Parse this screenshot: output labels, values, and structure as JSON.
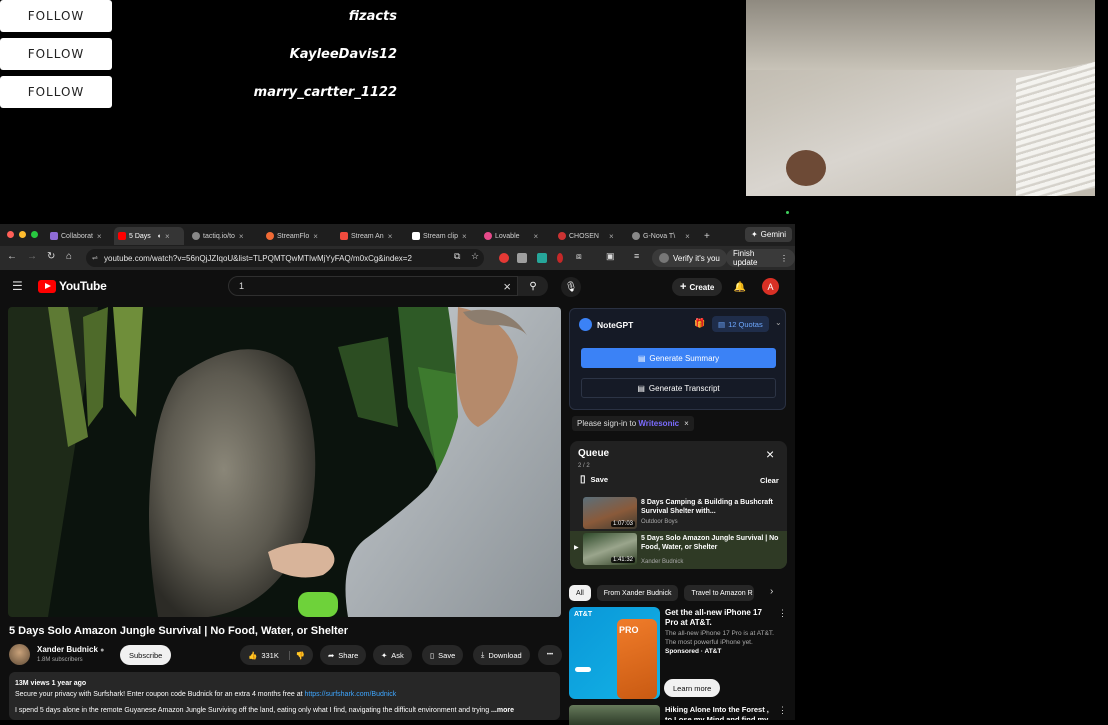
{
  "overlay": {
    "follows": [
      {
        "button": "FOLLOW",
        "name": "fizacts"
      },
      {
        "button": "FOLLOW",
        "name": "KayleeDavis12"
      },
      {
        "button": "FOLLOW",
        "name": "marry_cartter_1122"
      }
    ]
  },
  "browser": {
    "tabs": [
      {
        "label": "Collaborat",
        "close": "×",
        "color": "#8e6bd6"
      },
      {
        "label": "5 Days",
        "close": "×",
        "color": "#ff0000"
      },
      {
        "label": "tactiq.io/to",
        "close": "×",
        "color": "#888888"
      },
      {
        "label": "StreamFlo",
        "close": "×",
        "color": "#f06a35"
      },
      {
        "label": "Stream An",
        "close": "×",
        "color": "#f24b3e"
      },
      {
        "label": "Stream clip",
        "close": "×",
        "color": "#ffffff"
      },
      {
        "label": "Lovable",
        "close": "×",
        "color": "#e64a8a"
      },
      {
        "label": "CHOSEN",
        "close": "×",
        "color": "#cc3333"
      },
      {
        "label": "G-Nova T\\",
        "close": "×",
        "color": "#888888"
      }
    ],
    "new_tab": "+",
    "gemini": "Gemini",
    "url": "youtube.com/watch?v=56nQjJZIqoU&list=TLPQMTQwMTIwMjYyFAQ/m0xCg&index=2",
    "verify": "Verify it's you",
    "finish_update": "Finish update"
  },
  "youtube": {
    "logo": "YouTube",
    "search_value": "1",
    "search_clear": "×",
    "create": "Create",
    "avatar_letter": "A",
    "video_title": "5 Days Solo Amazon Jungle Survival | No Food, Water, or Shelter",
    "channel": "Xander Budnick",
    "subscribers": "1.8M subscribers",
    "subscribe": "Subscribe",
    "likes": "331K",
    "share": "Share",
    "ask": "Ask",
    "save": "Save",
    "download": "Download",
    "more": "•••",
    "views_line": "13M views  1 year ago",
    "promo_text": "Secure your privacy with Surfshark! Enter coupon code Budnick for an extra 4 months free at ",
    "promo_link": "https://surfshark.com/Budnick",
    "desc_line": "I spend 5 days alone in the remote Guyanese Amazon Jungle Surviving off the land, eating only what I find, navigating the difficult environment and trying",
    "desc_more": "...more"
  },
  "notegpt": {
    "name": "NoteGPT",
    "quotas": "12 Quotas",
    "generate_summary": "Generate Summary",
    "generate_transcript": "Generate Transcript"
  },
  "writesonic": {
    "prefix": "Please sign-in to ",
    "brand": "Writesonic",
    "close": "×"
  },
  "queue": {
    "title": "Queue",
    "count": "2 / 2",
    "close": "×",
    "save": "Save",
    "clear": "Clear",
    "items": [
      {
        "title": "8 Days Camping & Building a Bushcraft Survival Shelter with...",
        "channel": "Outdoor Boys",
        "duration": "1:07:03"
      },
      {
        "title": "5 Days Solo Amazon Jungle Survival | No Food, Water, or Shelter",
        "channel": "Xander Budnick",
        "duration": "1:41:32",
        "playing": "▶"
      }
    ]
  },
  "chips": [
    "All",
    "From Xander Budnick",
    "Travel to Amazon R"
  ],
  "ad": {
    "title": "Get the all-new iPhone 17 Pro at AT&T.",
    "body": "The all-new iPhone 17 Pro is at AT&T. The most powerful iPhone yet.",
    "sponsored": "Sponsored · AT&T",
    "learn_more": "Learn more",
    "brand": "AT&T",
    "badge": "PRO"
  },
  "rec": {
    "title": "Hiking Alone Into the Forest , to Lose my Mind and find my Soul"
  },
  "colors": {
    "accent_blue": "#3b82f6",
    "yt_red": "#ff0000",
    "link": "#3ea6ff",
    "writesonic": "#7b6cff"
  }
}
